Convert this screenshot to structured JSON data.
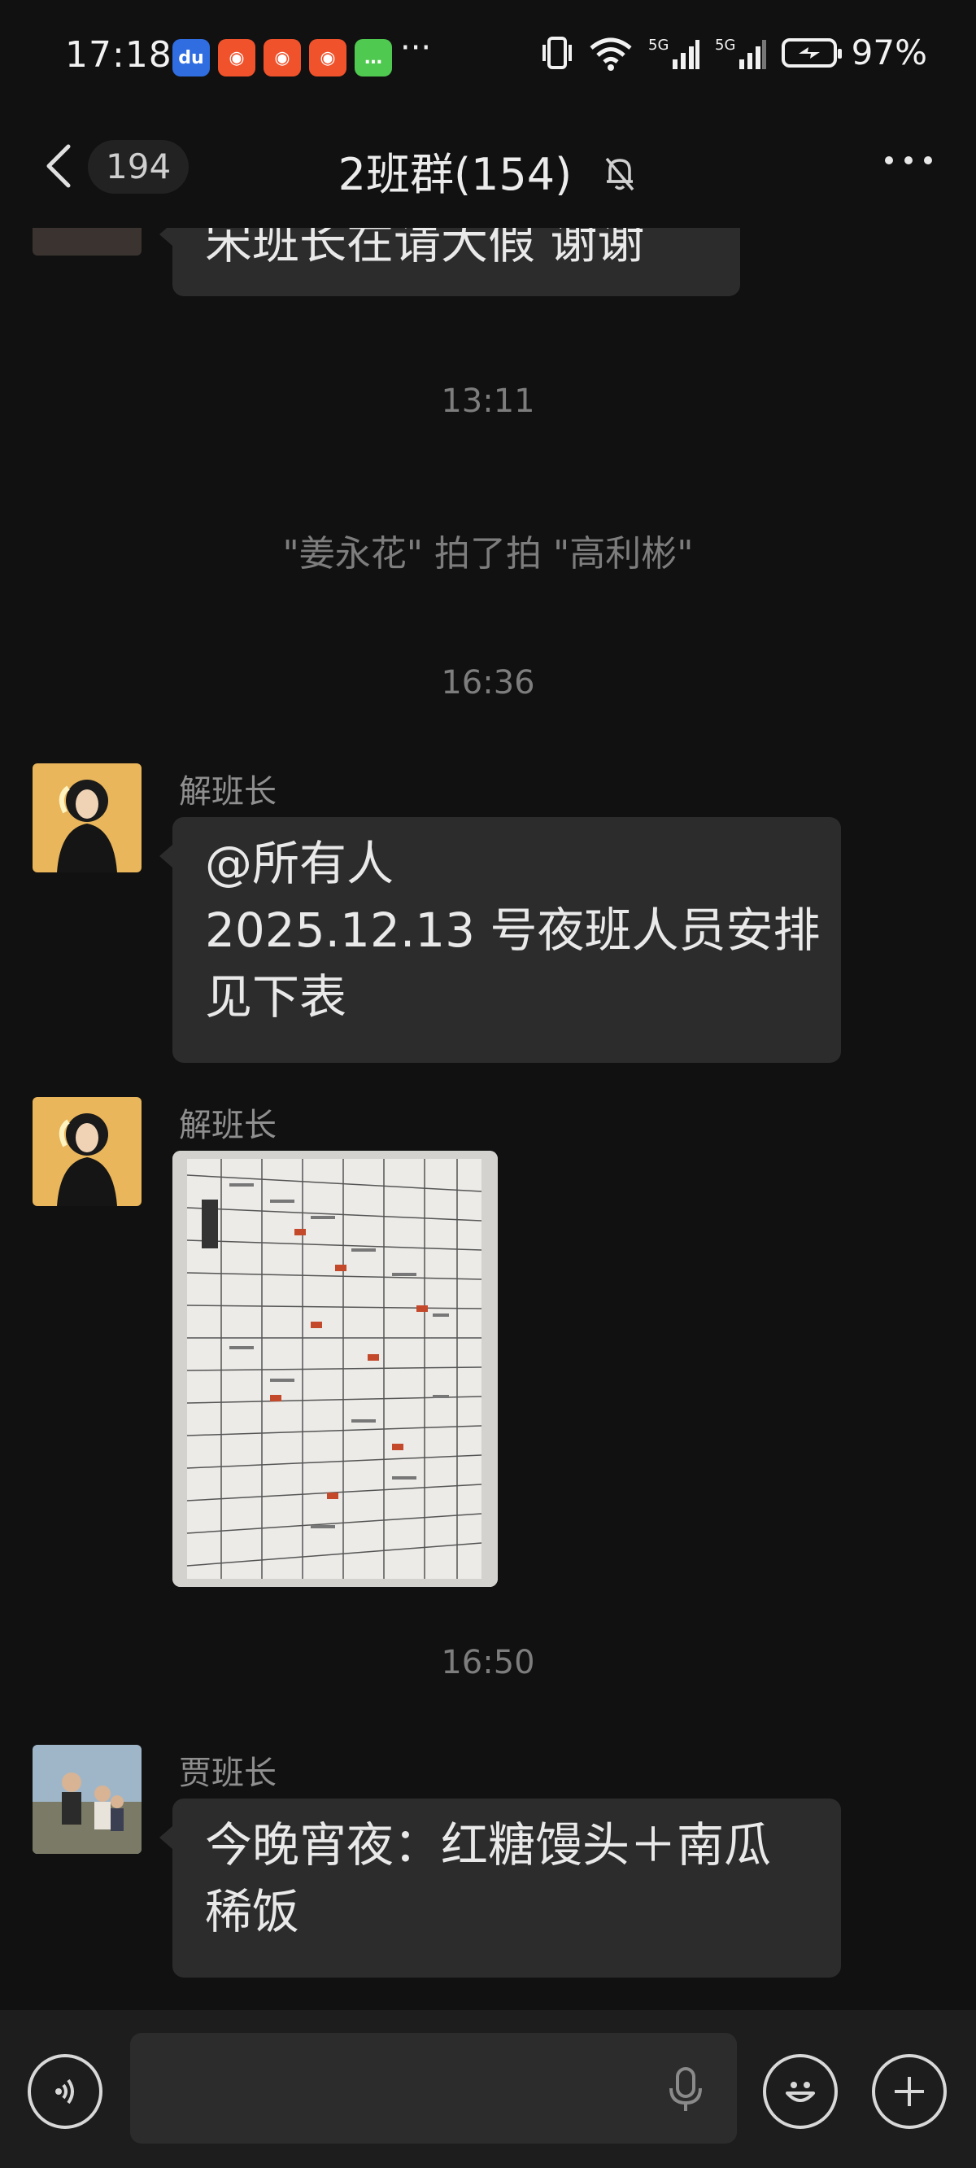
{
  "status_bar": {
    "time": "17:18",
    "app_icons": [
      "baidu-icon",
      "kuaishou-icon",
      "kuaishou-lite-icon",
      "kuaishou-icon",
      "message-icon"
    ],
    "more": "···",
    "battery_percent": "97%",
    "signals": [
      "vibrate-icon",
      "wifi-icon",
      "5g-signal-icon",
      "5g-signal-icon",
      "charging-battery-icon"
    ]
  },
  "header": {
    "back_count": "194",
    "title": "2班群(154)",
    "muted": true
  },
  "messages": {
    "partial_text": "宋班长在请大假   谢谢",
    "time_1": "13:11",
    "system_text": "\"姜永花\" 拍了拍 \"高利彬\"",
    "time_2": "16:36",
    "msg1_sender": "解班长",
    "msg1_lines": [
      "@所有人",
      "2025.12.13 号夜班人员安排",
      "见下表"
    ],
    "msg2_sender": "解班长",
    "time_3": "16:50",
    "msg3_sender": "贾班长",
    "msg3_lines": [
      "今晚宵夜：红糖馒头＋南瓜",
      "稀饭"
    ]
  },
  "input_bar": {
    "placeholder": ""
  },
  "colors": {
    "background": "#111111",
    "bubble": "#2c2c2c",
    "muted_text": "#7d7d7d"
  }
}
